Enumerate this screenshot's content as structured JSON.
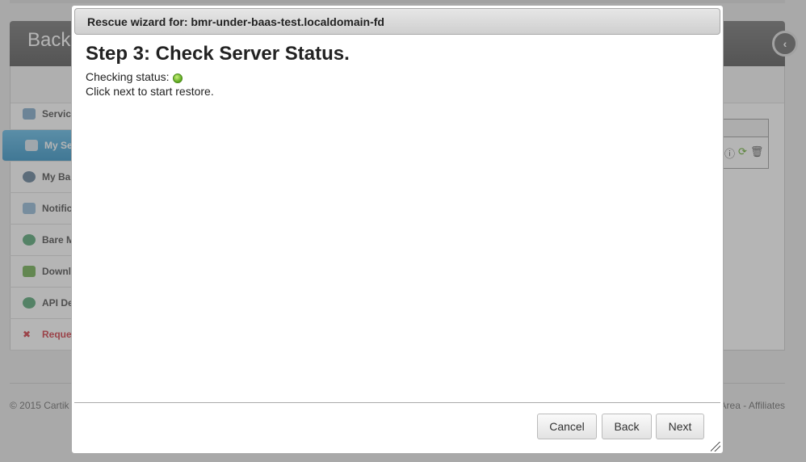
{
  "background": {
    "header_title": "Back",
    "sidebar": {
      "items": [
        {
          "label": "Servic",
          "icon": "monitor-icon"
        },
        {
          "label": "My Se",
          "icon": "server-icon",
          "active": true
        },
        {
          "label": "My Ba",
          "icon": "search-icon"
        },
        {
          "label": "Notific",
          "icon": "mail-icon"
        },
        {
          "label": "Bare M",
          "icon": "disk-icon"
        },
        {
          "label": "Downl",
          "icon": "download-icon"
        },
        {
          "label": "API De",
          "icon": "api-icon"
        },
        {
          "label": "Reque",
          "icon": "close-icon",
          "alert": true
        }
      ]
    },
    "table_icons": [
      "info-icon",
      "refresh-icon",
      "trash-icon"
    ],
    "footer": {
      "copyright": "© 2015 Cartik",
      "links": "Area - Affiliates"
    }
  },
  "dialog": {
    "title": "Rescue wizard for: bmr-under-baas-test.localdomain-fd",
    "heading": "Step 3: Check Server Status.",
    "status_label": "Checking status:",
    "status_color": "#5aa71d",
    "hint": "Click next to start restore.",
    "buttons": {
      "cancel": "Cancel",
      "back": "Back",
      "next": "Next"
    }
  },
  "colors": {
    "active_sidebar": "#2b8fc4",
    "alert": "#d0313b"
  }
}
